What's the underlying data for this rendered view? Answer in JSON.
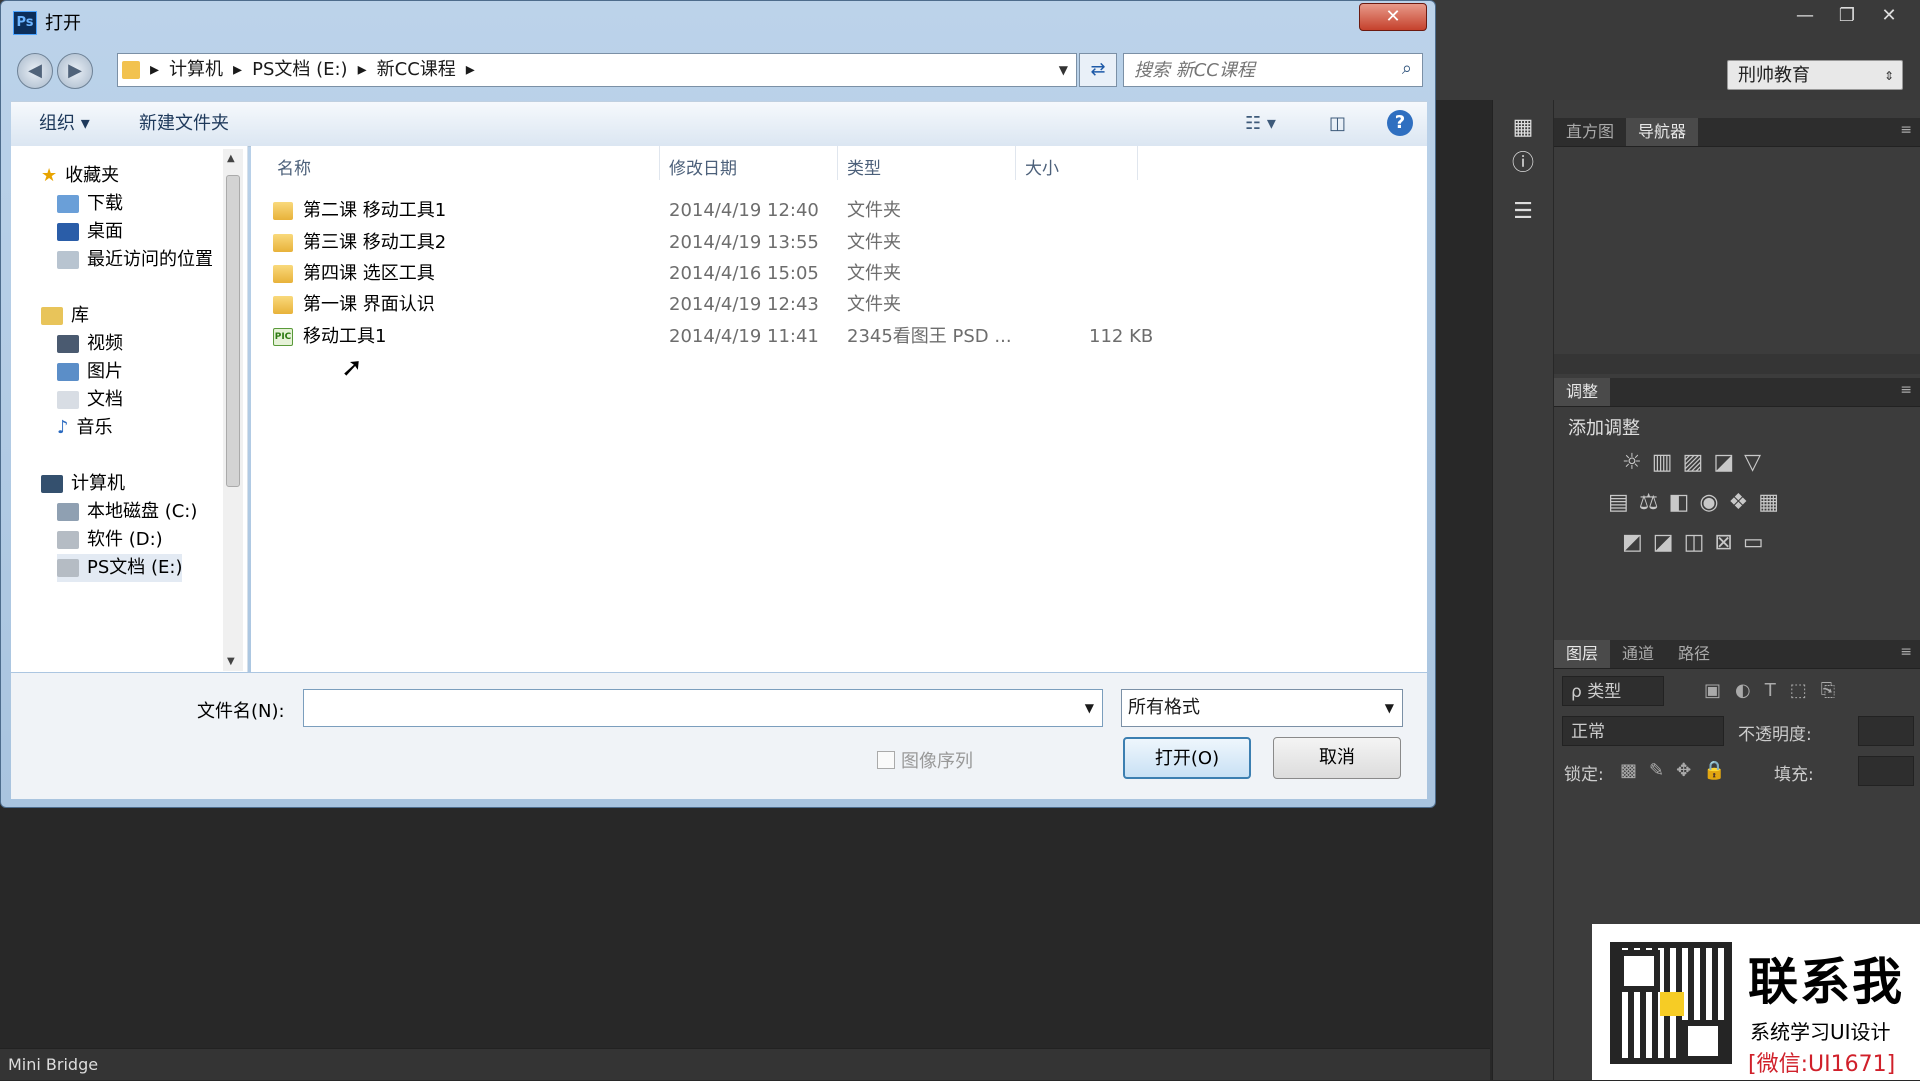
{
  "dialog": {
    "title": "打开",
    "close_label": "✕",
    "nav": {
      "path": [
        "计算机",
        "PS文档 (E:)",
        "新CC课程"
      ],
      "search_placeholder": "搜索 新CC课程"
    },
    "toolbar": {
      "organize": "组织 ▾",
      "new_folder": "新建文件夹"
    },
    "sidebar": {
      "favorites": "收藏夹",
      "favorites_items": [
        "下载",
        "桌面",
        "最近访问的位置"
      ],
      "libraries": "库",
      "library_items": [
        "视频",
        "图片",
        "文档",
        "音乐"
      ],
      "computer": "计算机",
      "computer_items": [
        "本地磁盘 (C:)",
        "软件 (D:)",
        "PS文档 (E:)"
      ]
    },
    "columns": [
      "名称",
      "修改日期",
      "类型",
      "大小"
    ],
    "files": [
      {
        "name": "第二课 移动工具1",
        "date": "2014/4/19 12:40",
        "type": "文件夹",
        "size": "",
        "kind": "folder"
      },
      {
        "name": "第三课 移动工具2",
        "date": "2014/4/19 13:55",
        "type": "文件夹",
        "size": "",
        "kind": "folder"
      },
      {
        "name": "第四课 选区工具",
        "date": "2014/4/16 15:05",
        "type": "文件夹",
        "size": "",
        "kind": "folder"
      },
      {
        "name": "第一课 界面认识",
        "date": "2014/4/19 12:43",
        "type": "文件夹",
        "size": "",
        "kind": "folder"
      },
      {
        "name": "移动工具1",
        "date": "2014/4/19 11:41",
        "type": "2345看图王 PSD ...",
        "size": "112 KB",
        "kind": "psd"
      }
    ],
    "filename_label": "文件名(N):",
    "filename_value": "",
    "format": "所有格式",
    "image_sequence": "图像序列",
    "open_button": "打开(O)",
    "cancel_button": "取消"
  },
  "photoshop": {
    "workspace": "刑帅教育",
    "panel_tabs_top": [
      "直方图",
      "导航器"
    ],
    "adjustments_tab": "调整",
    "add_adjustment": "添加调整",
    "layer_tabs": [
      "图层",
      "通道",
      "路径"
    ],
    "filter_kind": "ρ 类型",
    "blend_mode": "正常",
    "opacity_label": "不透明度:",
    "lock_label": "锁定:",
    "fill_label": "填充:",
    "mini_bridge": "Mini Bridge"
  },
  "promo": {
    "headline": "联系我",
    "subline": "系统学习UI设计",
    "wechat": "[微信:UI1671]"
  }
}
